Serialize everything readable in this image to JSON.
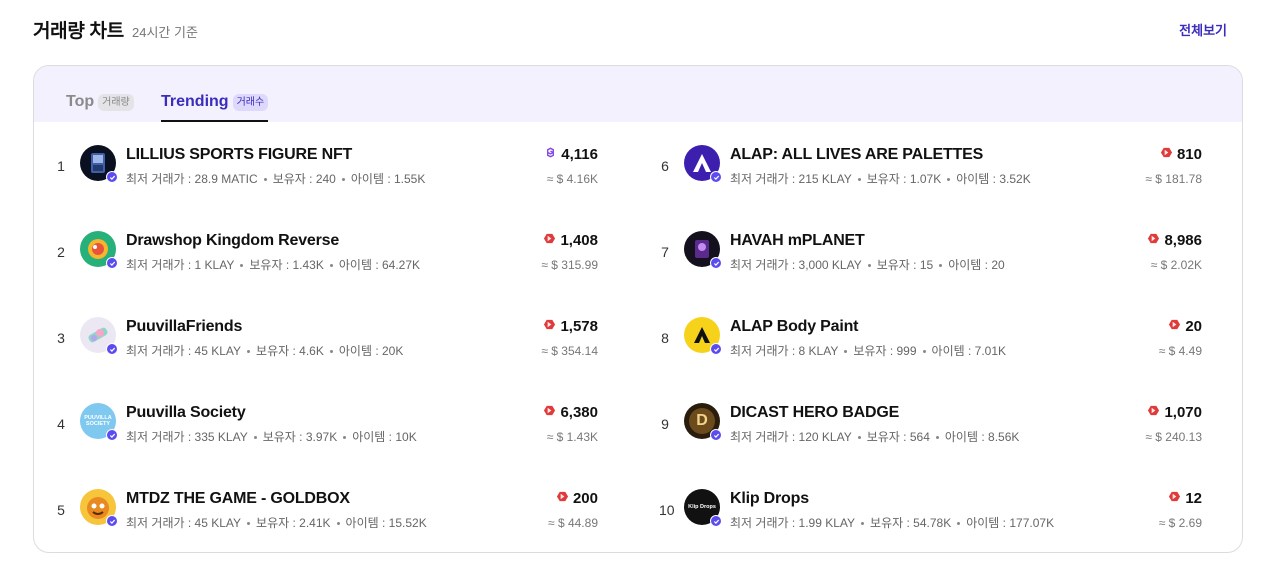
{
  "header": {
    "title": "거래량 차트",
    "subtitle": "24시간 기준",
    "view_all": "전체보기"
  },
  "tabs": [
    {
      "label": "Top",
      "badge": "거래량",
      "active": false
    },
    {
      "label": "Trending",
      "badge": "거래수",
      "active": true
    }
  ],
  "meta_labels": {
    "floor": "최저 거래가 :",
    "owners": "보유자 :",
    "items": "아이템 :"
  },
  "rows": [
    {
      "rank": "1",
      "name": "LILLIUS SPORTS FIGURE NFT",
      "floor": "28.9 MATIC",
      "owners": "240",
      "items": "1.55K",
      "volume": "4,116",
      "usd": "≈ $ 4.16K",
      "coin": "matic-icon"
    },
    {
      "rank": "2",
      "name": "Drawshop Kingdom Reverse",
      "floor": "1 KLAY",
      "owners": "1.43K",
      "items": "64.27K",
      "volume": "1,408",
      "usd": "≈ $ 315.99",
      "coin": "klay-icon"
    },
    {
      "rank": "3",
      "name": "PuuvillaFriends",
      "floor": "45 KLAY",
      "owners": "4.6K",
      "items": "20K",
      "volume": "1,578",
      "usd": "≈ $ 354.14",
      "coin": "klay-icon"
    },
    {
      "rank": "4",
      "name": "Puuvilla Society",
      "floor": "335 KLAY",
      "owners": "3.97K",
      "items": "10K",
      "volume": "6,380",
      "usd": "≈ $ 1.43K",
      "coin": "klay-icon"
    },
    {
      "rank": "5",
      "name": "MTDZ THE GAME - GOLDBOX",
      "floor": "45 KLAY",
      "owners": "2.41K",
      "items": "15.52K",
      "volume": "200",
      "usd": "≈ $ 44.89",
      "coin": "klay-icon"
    },
    {
      "rank": "6",
      "name": "ALAP: ALL LIVES ARE PALETTES",
      "floor": "215 KLAY",
      "owners": "1.07K",
      "items": "3.52K",
      "volume": "810",
      "usd": "≈ $ 181.78",
      "coin": "klay-icon"
    },
    {
      "rank": "7",
      "name": "HAVAH mPLANET",
      "floor": "3,000 KLAY",
      "owners": "15",
      "items": "20",
      "volume": "8,986",
      "usd": "≈ $ 2.02K",
      "coin": "klay-icon"
    },
    {
      "rank": "8",
      "name": "ALAP Body Paint",
      "floor": "8 KLAY",
      "owners": "999",
      "items": "7.01K",
      "volume": "20",
      "usd": "≈ $ 4.49",
      "coin": "klay-icon"
    },
    {
      "rank": "9",
      "name": "DICAST HERO BADGE",
      "floor": "120 KLAY",
      "owners": "564",
      "items": "8.56K",
      "volume": "1,070",
      "usd": "≈ $ 240.13",
      "coin": "klay-icon"
    },
    {
      "rank": "10",
      "name": "Klip Drops",
      "floor": "1.99 KLAY",
      "owners": "54.78K",
      "items": "177.07K",
      "volume": "12",
      "usd": "≈ $ 2.69",
      "coin": "klay-icon"
    }
  ],
  "avatars": [
    {
      "icon": "lillius-avatar-icon",
      "text": ""
    },
    {
      "icon": "drawshop-avatar-icon",
      "text": ""
    },
    {
      "icon": "puuvilla-friends-avatar-icon",
      "text": ""
    },
    {
      "icon": "puuvilla-society-avatar-icon",
      "text": "PUUVILLA SOCIETY"
    },
    {
      "icon": "mtdz-avatar-icon",
      "text": ""
    },
    {
      "icon": "alap-avatar-icon",
      "text": ""
    },
    {
      "icon": "havah-avatar-icon",
      "text": ""
    },
    {
      "icon": "alap-body-paint-avatar-icon",
      "text": ""
    },
    {
      "icon": "dicast-avatar-icon",
      "text": "D"
    },
    {
      "icon": "klip-drops-avatar-icon",
      "text": "Klip Drops"
    }
  ],
  "colors": {
    "accent": "#3a2dbd",
    "tab_bg": "#f2f1fd",
    "verify": "#5b4cf0",
    "klay": "#e03a3a",
    "matic": "#8247e5"
  }
}
